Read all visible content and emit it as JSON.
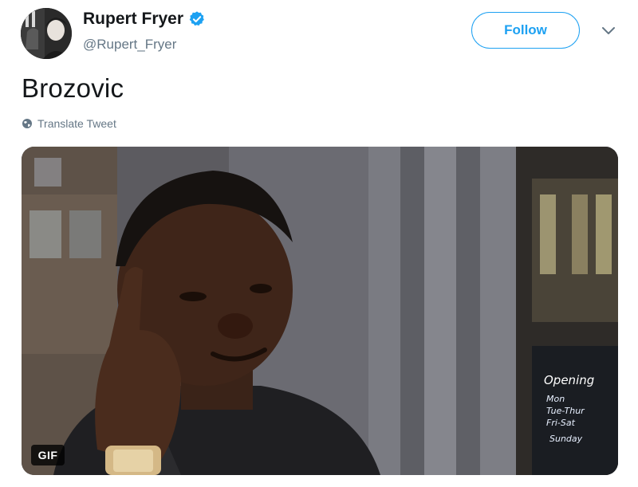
{
  "tweet": {
    "display_name": "Rupert Fryer",
    "handle": "@Rupert_Fryer",
    "text": "Brozovic",
    "translate_label": "Translate Tweet",
    "verified": true
  },
  "actions": {
    "follow_label": "Follow"
  },
  "media": {
    "type": "gif",
    "badge_label": "GIF",
    "sign_text": [
      "Opening",
      "Mon",
      "Tue-Thur",
      "Fri-Sat",
      "Sunday"
    ]
  },
  "colors": {
    "accent": "#1da1f2",
    "text_primary": "#14171a",
    "text_secondary": "#657786"
  },
  "icons": {
    "verified": "verified-badge-icon",
    "chevron": "chevron-down-icon",
    "globe": "globe-icon"
  }
}
